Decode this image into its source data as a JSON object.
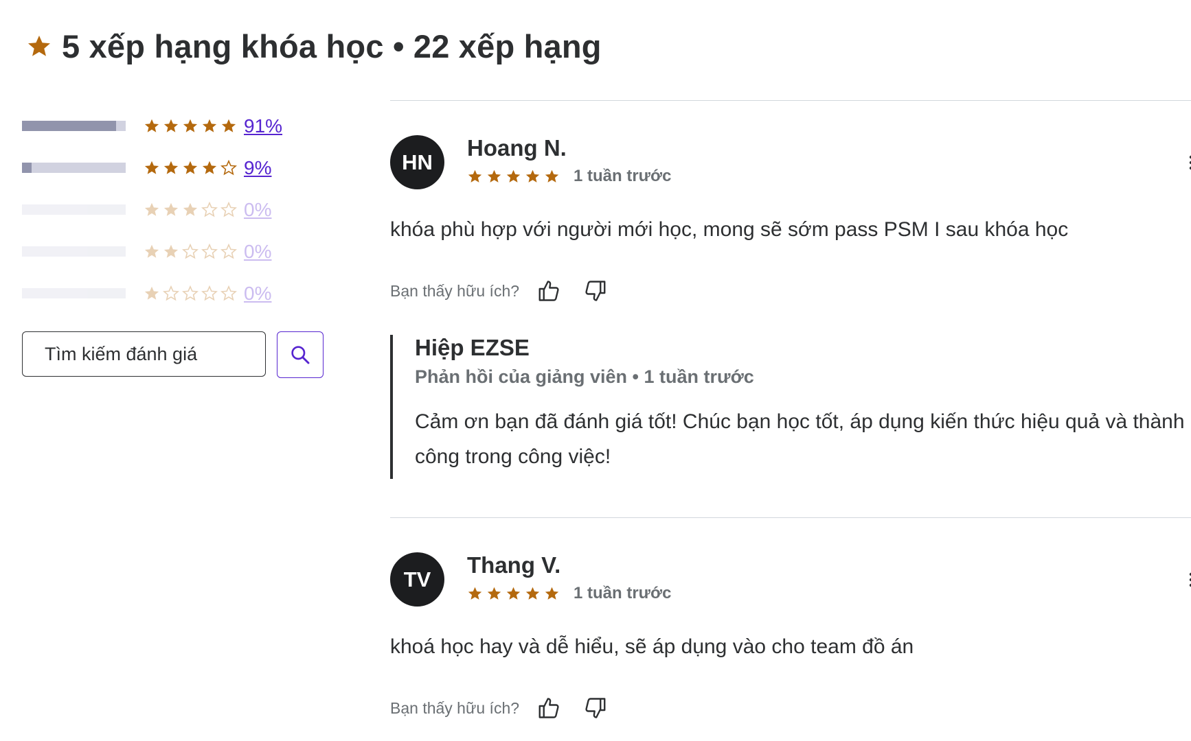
{
  "header": {
    "title": "5 xếp hạng khóa học • 22 xếp hạng"
  },
  "histogram": [
    {
      "stars": 5,
      "percent_label": "91%",
      "fill": 0.91,
      "enabled": true
    },
    {
      "stars": 4,
      "percent_label": "9%",
      "fill": 0.09,
      "enabled": true
    },
    {
      "stars": 3,
      "percent_label": "0%",
      "fill": 0,
      "enabled": false
    },
    {
      "stars": 2,
      "percent_label": "0%",
      "fill": 0,
      "enabled": false
    },
    {
      "stars": 1,
      "percent_label": "0%",
      "fill": 0,
      "enabled": false
    }
  ],
  "search": {
    "placeholder": "Tìm kiếm đánh giá"
  },
  "reviews": [
    {
      "initials": "HN",
      "name": "Hoang N.",
      "rating": 5,
      "date": "1 tuần trước",
      "text": "khóa phù hợp với người mới học, mong sẽ sớm pass PSM I sau khóa học",
      "helpful_label": "Bạn thấy hữu ích?",
      "response": {
        "name": "Hiệp EZSE",
        "subtitle": "Phản hồi của giảng viên • 1 tuần trước",
        "text": "Cảm ơn bạn đã đánh giá tốt! Chúc bạn học tốt, áp dụng kiến thức hiệu quả và thành công trong công việc!"
      }
    },
    {
      "initials": "TV",
      "name": "Thang V.",
      "rating": 5,
      "date": "1 tuần trước",
      "text": "khoá học hay và dễ hiểu, sẽ áp dụng vào cho team đồ án",
      "helpful_label": "Bạn thấy hữu ích?"
    }
  ],
  "icons": {
    "star": "star-icon",
    "search": "search-icon",
    "thumbs_up": "thumbs-up-icon",
    "thumbs_down": "thumbs-down-icon",
    "more": "more-vertical-icon"
  },
  "colors": {
    "star": "#b4690e",
    "link": "#5624d0",
    "bar_fill": "#9194ac",
    "bar_track": "#d1d2e0",
    "avatar_bg": "#1c1d1f"
  }
}
